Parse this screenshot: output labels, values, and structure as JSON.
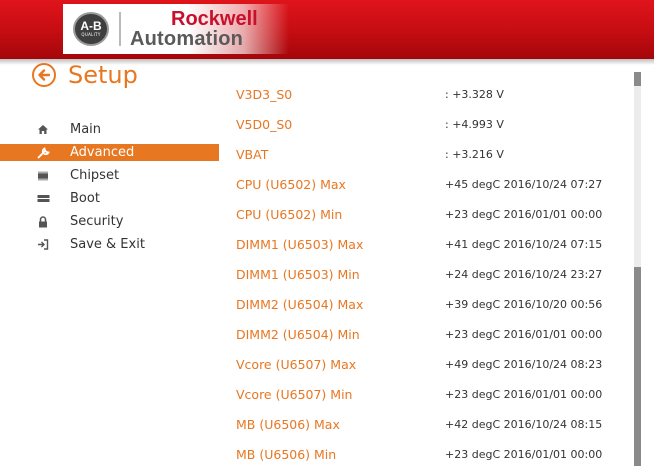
{
  "header": {
    "ab_logo_text": "A-B",
    "ab_logo_sub": "QUALITY",
    "brand_line1": "Rockwell",
    "brand_line2": "Automation"
  },
  "page": {
    "title": "Setup"
  },
  "nav": {
    "items": [
      {
        "label": "Main",
        "icon": "home-icon"
      },
      {
        "label": "Advanced",
        "icon": "wrench-icon"
      },
      {
        "label": "Chipset",
        "icon": "chip-icon"
      },
      {
        "label": "Boot",
        "icon": "drive-icon"
      },
      {
        "label": "Security",
        "icon": "lock-icon"
      },
      {
        "label": "Save & Exit",
        "icon": "exit-icon"
      }
    ],
    "active_index": 1
  },
  "rows": [
    {
      "label": "V3D3_S0",
      "value": ": +3.328 V"
    },
    {
      "label": "V5D0_S0",
      "value": ": +4.993 V"
    },
    {
      "label": "VBAT",
      "value": ": +3.216 V"
    },
    {
      "label": "CPU (U6502) Max",
      "value": "+45 degC 2016/10/24 07:27"
    },
    {
      "label": "CPU (U6502) Min",
      "value": "+23 degC 2016/01/01 00:00"
    },
    {
      "label": "DIMM1 (U6503) Max",
      "value": "+41 degC 2016/10/24 07:15"
    },
    {
      "label": "DIMM1 (U6503) Min",
      "value": "+24 degC 2016/10/24 23:27"
    },
    {
      "label": "DIMM2 (U6504) Max",
      "value": "+39 degC 2016/10/20 00:56"
    },
    {
      "label": "DIMM2 (U6504) Min",
      "value": "+23 degC 2016/01/01 00:00"
    },
    {
      "label": "Vcore (U6507) Max",
      "value": "+49 degC 2016/10/24 08:23"
    },
    {
      "label": "Vcore (U6507) Min",
      "value": "+23 degC 2016/01/01 00:00"
    },
    {
      "label": "MB (U6506) Max",
      "value": "+42 degC 2016/10/24 08:15"
    },
    {
      "label": "MB (U6506) Min",
      "value": "+23 degC 2016/01/01 00:00"
    }
  ],
  "colors": {
    "accent": "#e87722",
    "header_red": "#c40d12"
  }
}
